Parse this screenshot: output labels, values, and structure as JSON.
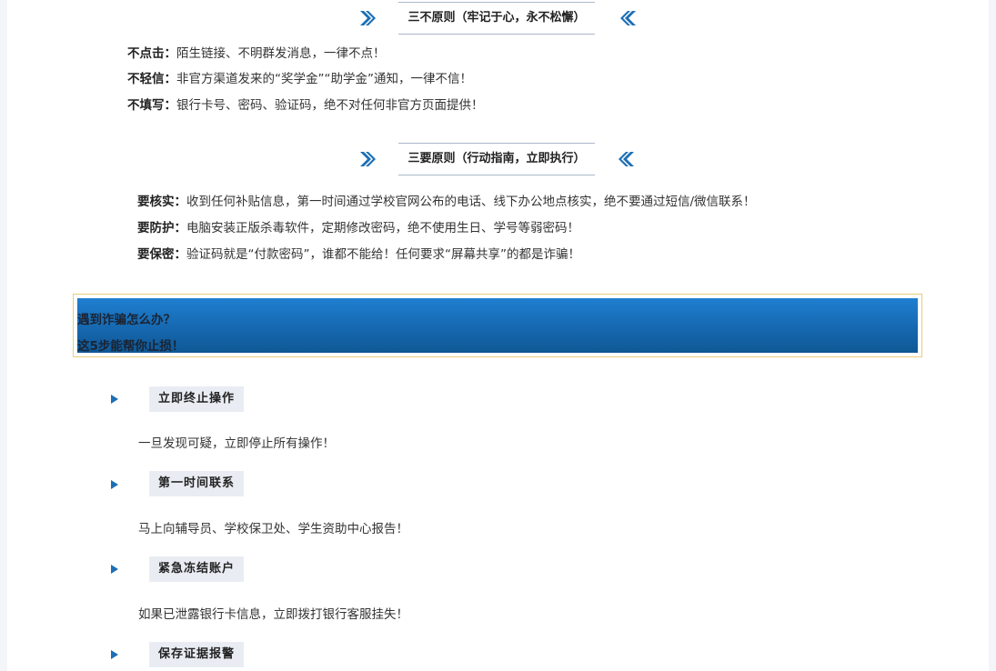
{
  "section1": {
    "title": "三不原则（牢记于心，永不松懈）",
    "items": [
      {
        "label": "不点击：",
        "text": "陌生链接、不明群发消息，一律不点！"
      },
      {
        "label": "不轻信：",
        "text": "非官方渠道发来的“奖学金”“助学金”通知，一律不信！"
      },
      {
        "label": "不填写：",
        "text": "银行卡号、密码、验证码，绝不对任何非官方页面提供！"
      }
    ]
  },
  "section2": {
    "title": "三要原则（行动指南，立即执行）",
    "items": [
      {
        "label": "要核实：",
        "text": "收到任何补贴信息，第一时间通过学校官网公布的电话、线下办公地点核实，绝不要通过短信/微信联系！"
      },
      {
        "label": "要防护：",
        "text": "电脑安装正版杀毒软件，定期修改密码，绝不使用生日、学号等弱密码！"
      },
      {
        "label": "要保密：",
        "text": "验证码就是“付款密码”，谁都不能给！任何要求“屏幕共享”的都是诈骗！"
      }
    ]
  },
  "banner": {
    "line1": "遇到诈骗怎么办？",
    "line2": "这5步能帮你止损！"
  },
  "steps": [
    {
      "title": "立即终止操作",
      "desc": "一旦发现可疑，立即停止所有操作！"
    },
    {
      "title": "第一时间联系",
      "desc": "马上向辅导员、学校保卫处、学生资助中心报告！"
    },
    {
      "title": "紧急冻结账户",
      "desc": "如果已泄露银行卡信息，立即拨打银行客服挂失！"
    },
    {
      "title": "保存证据报警",
      "desc": ""
    }
  ],
  "colors": {
    "accent": "#1c6fb5",
    "banner_border": "#e7cf7a"
  },
  "icons": {
    "right_chevron": "double-chevron-right-icon",
    "left_chevron": "double-chevron-left-icon",
    "step_bullet": "triangle-right-icon"
  }
}
